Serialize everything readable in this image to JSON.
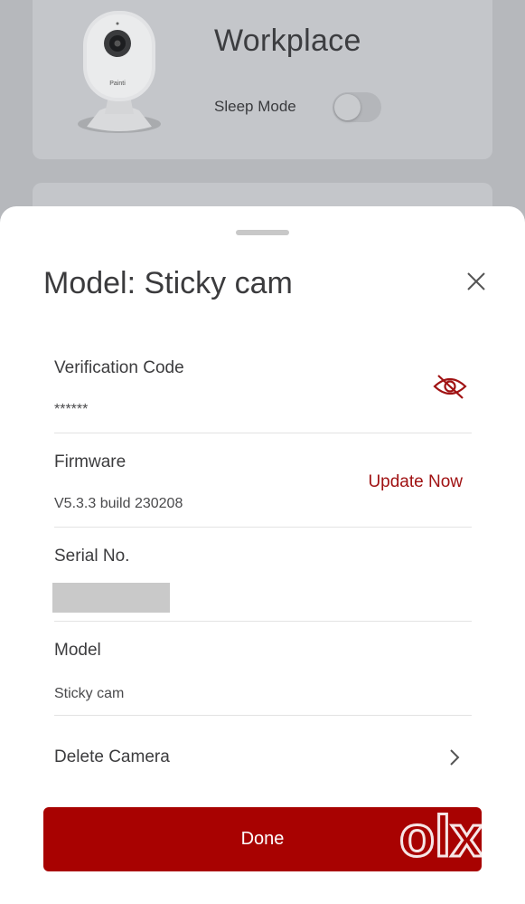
{
  "background": {
    "device_name": "Workplace",
    "sleep_mode_label": "Sleep Mode",
    "sleep_mode_on": false,
    "camera_brand": "Painti"
  },
  "sheet": {
    "title": "Model: Sticky cam",
    "fields": {
      "verification_code_label": "Verification Code",
      "verification_code_value": "******",
      "firmware_label": "Firmware",
      "firmware_value": "V5.3.3 build 230208",
      "update_now_label": "Update Now",
      "serial_label": "Serial No.",
      "model_label": "Model",
      "model_value": "Sticky cam"
    },
    "delete_camera_label": "Delete Camera",
    "done_label": "Done"
  },
  "colors": {
    "accent": "#a80201",
    "link": "#a01213",
    "overlay": "#b6b8bc"
  },
  "watermark_text": "olx"
}
